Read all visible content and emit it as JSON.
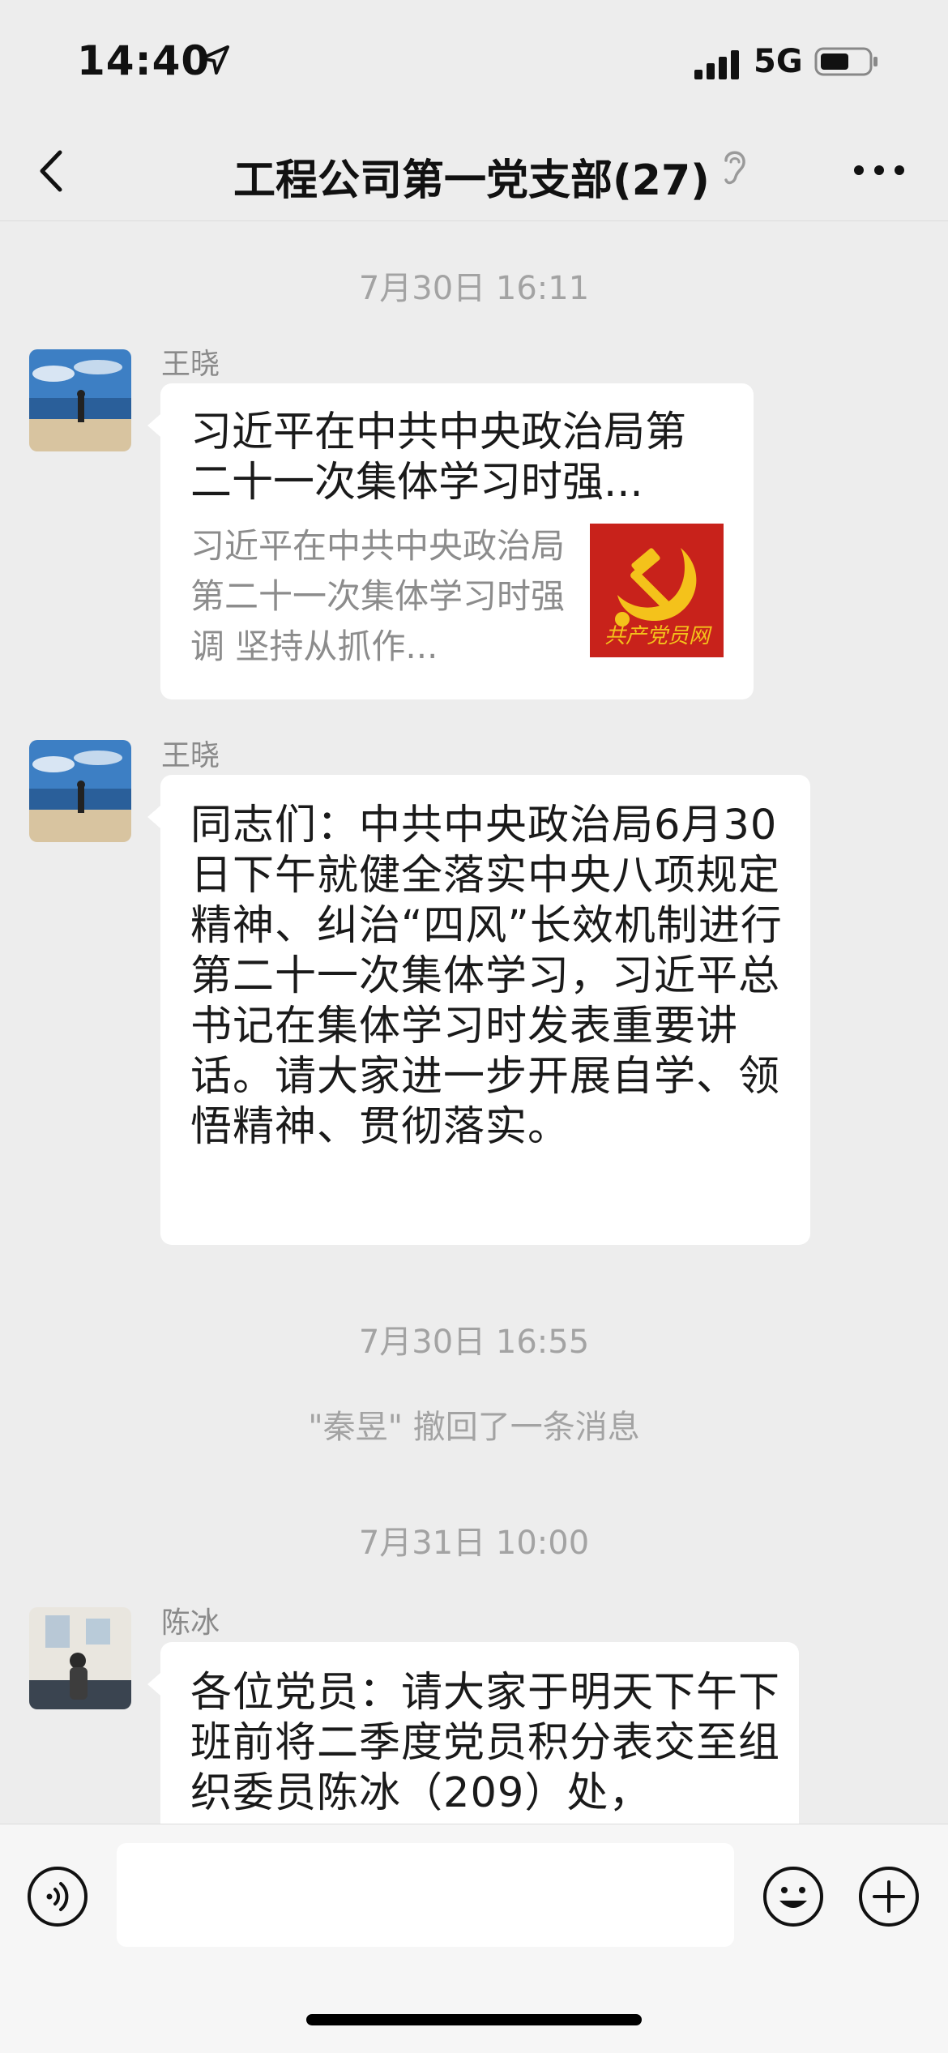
{
  "status_bar": {
    "time": "14:40",
    "network": "5G",
    "icons": [
      "location-arrow-icon",
      "signal-icon",
      "battery-icon"
    ]
  },
  "nav": {
    "title": "工程公司第一党支部(27)",
    "back_icon": "chevron-left-icon",
    "mute_icon": "muted-ear-icon",
    "more_icon": "more-dots-icon"
  },
  "chat": {
    "timestamps": [
      "7月30日 16:11",
      "7月30日 16:55",
      "7月31日 10:00"
    ],
    "messages": [
      {
        "sender": "王晓",
        "type": "link",
        "link_title": "习近平在中共中央政治局第二十一次集体学习时强...",
        "link_desc": "习近平在中共中央政治局第二十一次集体学习时强调  坚持从抓作...",
        "thumb_text": "共产党员网"
      },
      {
        "sender": "王晓",
        "type": "text",
        "text": "同志们：中共中央政治局6月30日下午就健全落实中央八项规定精神、纠治“四风”长效机制进行第二十一次集体学习，习近平总书记在集体学习时发表重要讲话。请大家进一步开展自学、领悟精神、贯彻落实。"
      },
      {
        "sender": "陈冰",
        "type": "text",
        "text": "各位党员：请大家于明天下午下班前将二季度党员积分表交至组织委员陈冰（209）处，"
      }
    ],
    "system_message": "\"秦昱\" 撤回了一条消息"
  },
  "input_bar": {
    "icons": [
      "voice-icon",
      "emoji-icon",
      "plus-icon"
    ]
  },
  "colors": {
    "background": "#ededed",
    "bubble": "#ffffff",
    "muted_text": "#a3a3a3",
    "party_red": "#c8221b",
    "party_gold": "#f4c21b"
  }
}
